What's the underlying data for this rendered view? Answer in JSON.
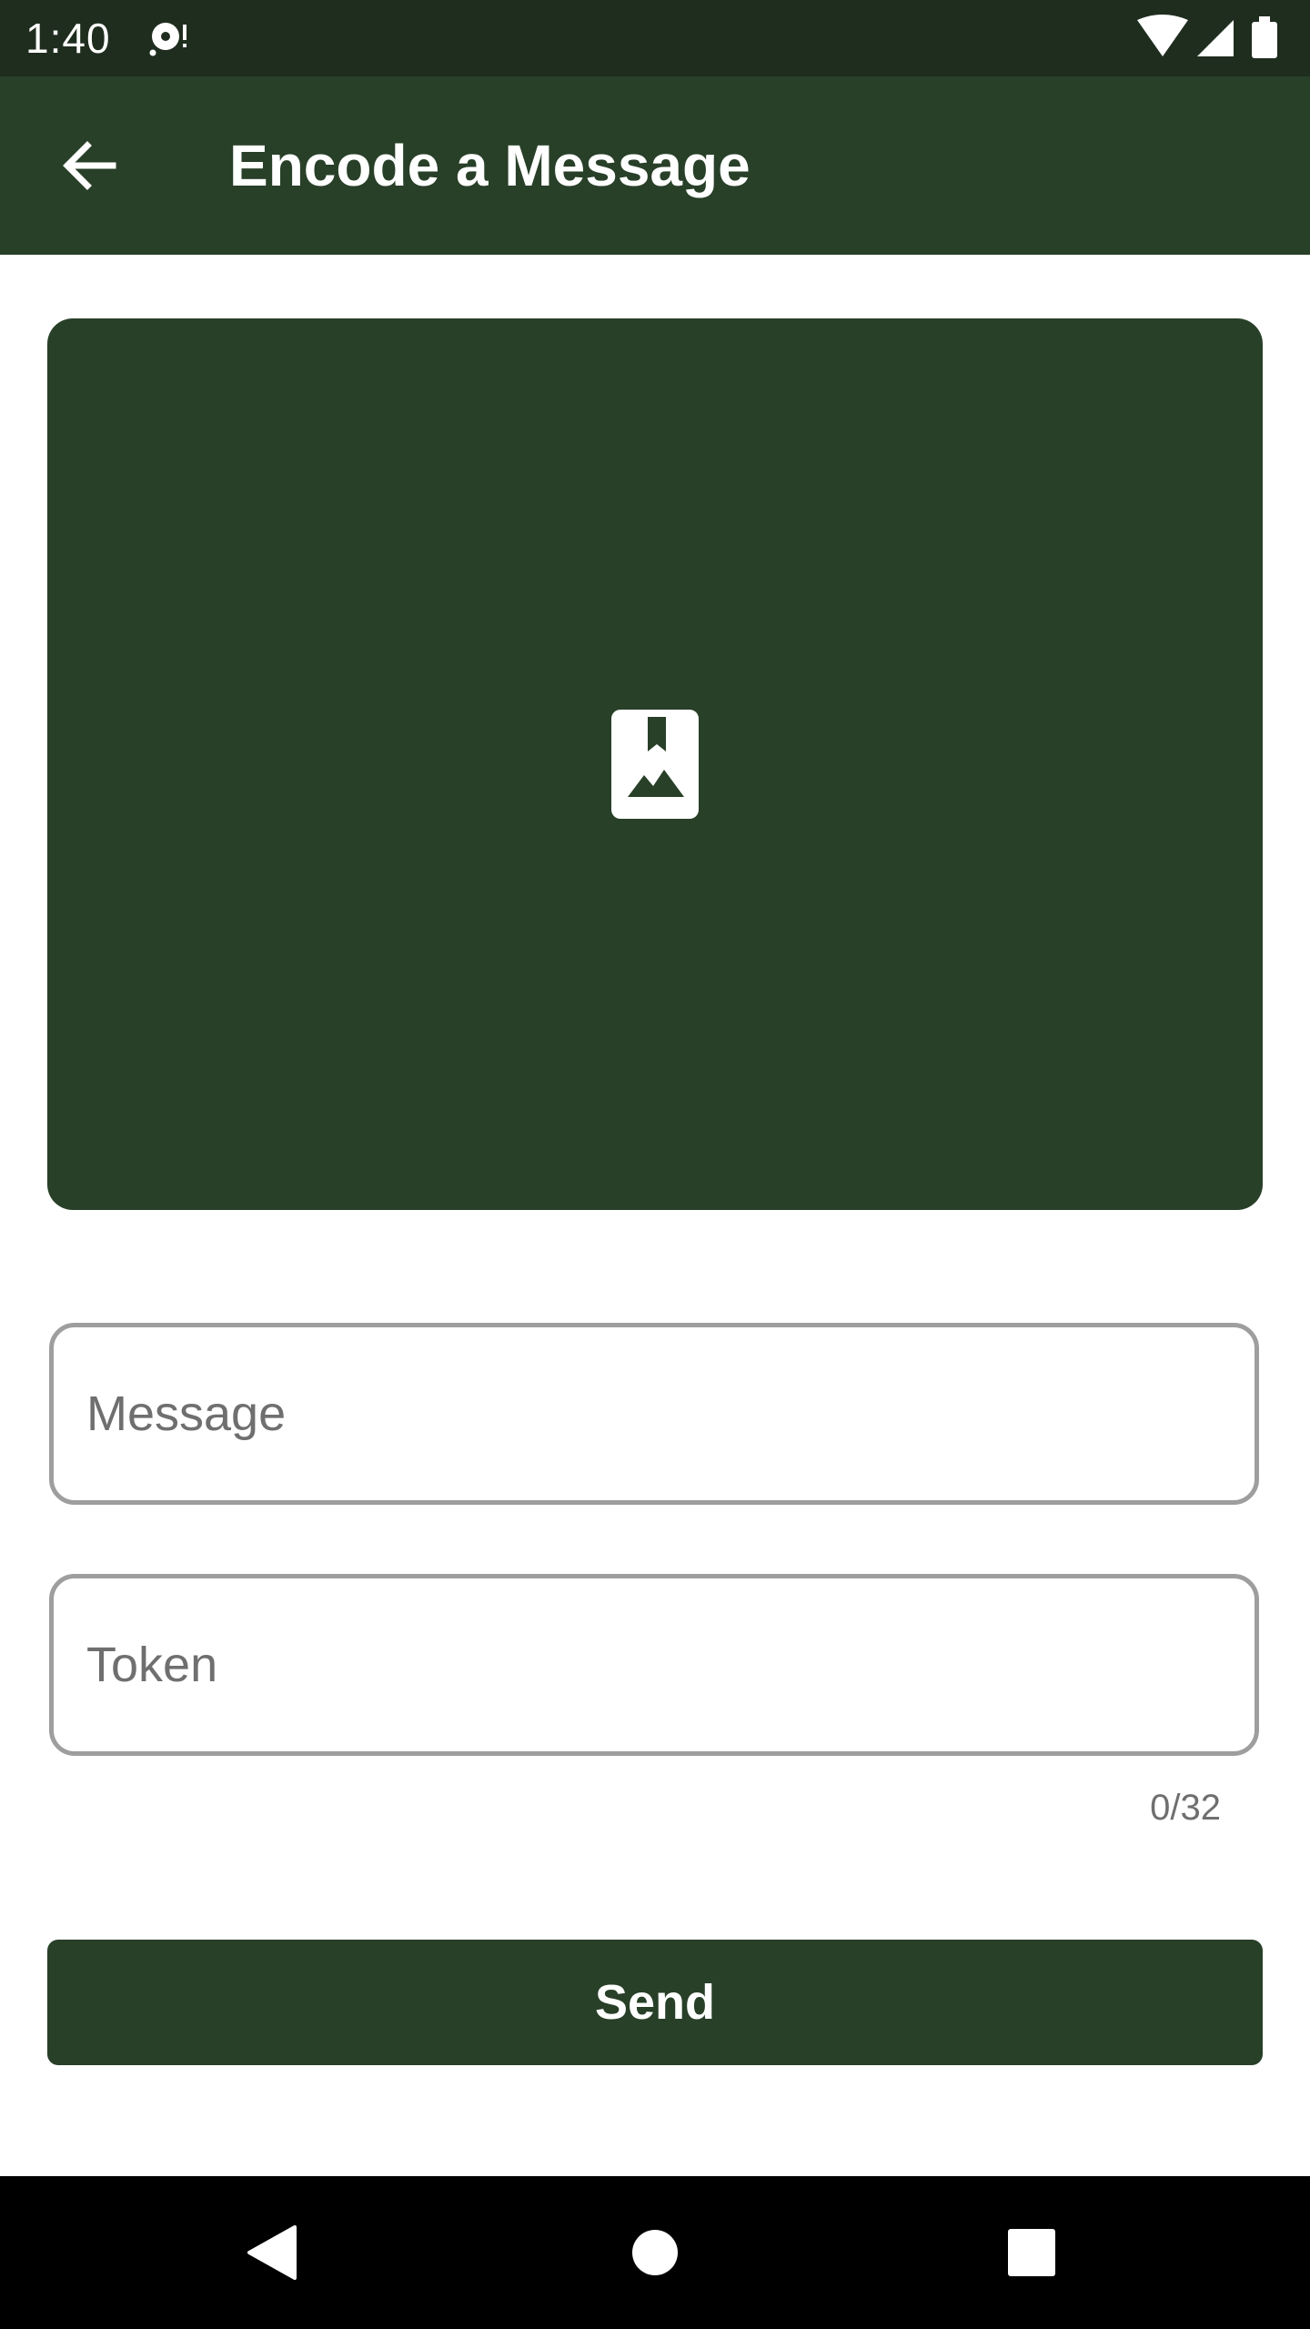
{
  "status_bar": {
    "time": "1:40",
    "icons": [
      "notification-icon",
      "wifi-icon",
      "signal-icon",
      "battery-icon"
    ]
  },
  "app_bar": {
    "title": "Encode a Message",
    "back_icon": "arrow-back-icon"
  },
  "image_picker": {
    "icon": "image-bookmark-icon"
  },
  "form": {
    "message": {
      "placeholder": "Message",
      "value": ""
    },
    "token": {
      "placeholder": "Token",
      "value": "",
      "counter": "0/32"
    },
    "send_label": "Send"
  },
  "nav_bar": {
    "icons": [
      "nav-back-icon",
      "nav-home-icon",
      "nav-recents-icon"
    ]
  },
  "colors": {
    "primary": "#283f28",
    "status_bar": "#1f2d1f",
    "field_border": "#9e9e9e",
    "hint_text": "#6f6f6f"
  }
}
